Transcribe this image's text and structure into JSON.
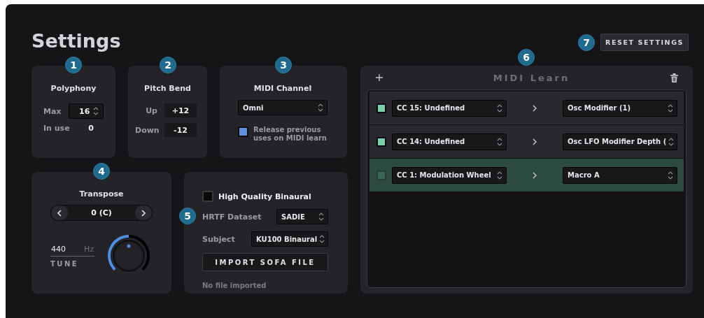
{
  "title": "Settings",
  "reset": {
    "badge": "7",
    "label": "RESET SETTINGS"
  },
  "polyphony": {
    "badge": "1",
    "title": "Polyphony",
    "max_label": "Max",
    "max_value": "16",
    "in_use_label": "In use",
    "in_use_value": "0"
  },
  "pitch_bend": {
    "badge": "2",
    "title": "Pitch Bend",
    "up_label": "Up",
    "up_value": "+12",
    "down_label": "Down",
    "down_value": "-12"
  },
  "midi_channel": {
    "badge": "3",
    "title": "MIDI Channel",
    "channel": "Omni",
    "release": {
      "label": "Release previous uses on MIDI learn",
      "checked": true
    }
  },
  "transpose": {
    "badge": "4",
    "title": "Transpose",
    "value": "0 (C)",
    "tune_value": "440",
    "tune_unit": "Hz",
    "tune_label": "TUNE",
    "level": 0.5
  },
  "binaural": {
    "badge": "5",
    "hq": {
      "label": "High Quality Binaural",
      "checked": false
    },
    "dataset_label": "HRTF Dataset",
    "dataset": "SADIE",
    "subject_label": "Subject",
    "subject": "KU100 Binaural",
    "import_button": "IMPORT SOFA FILE",
    "status": "No file imported"
  },
  "midi_learn": {
    "badge": "6",
    "title": "MIDI Learn",
    "mappings": [
      {
        "checked": true,
        "source": "CC 15: Undefined",
        "target": "Osc Modifier (1)",
        "selected": false
      },
      {
        "checked": true,
        "source": "CC 14: Undefined",
        "target": "Osc LFO Modifier Depth (",
        "selected": false
      },
      {
        "checked": false,
        "source": "CC 1: Modulation Wheel",
        "target": "Macro A",
        "selected": true
      }
    ]
  }
}
